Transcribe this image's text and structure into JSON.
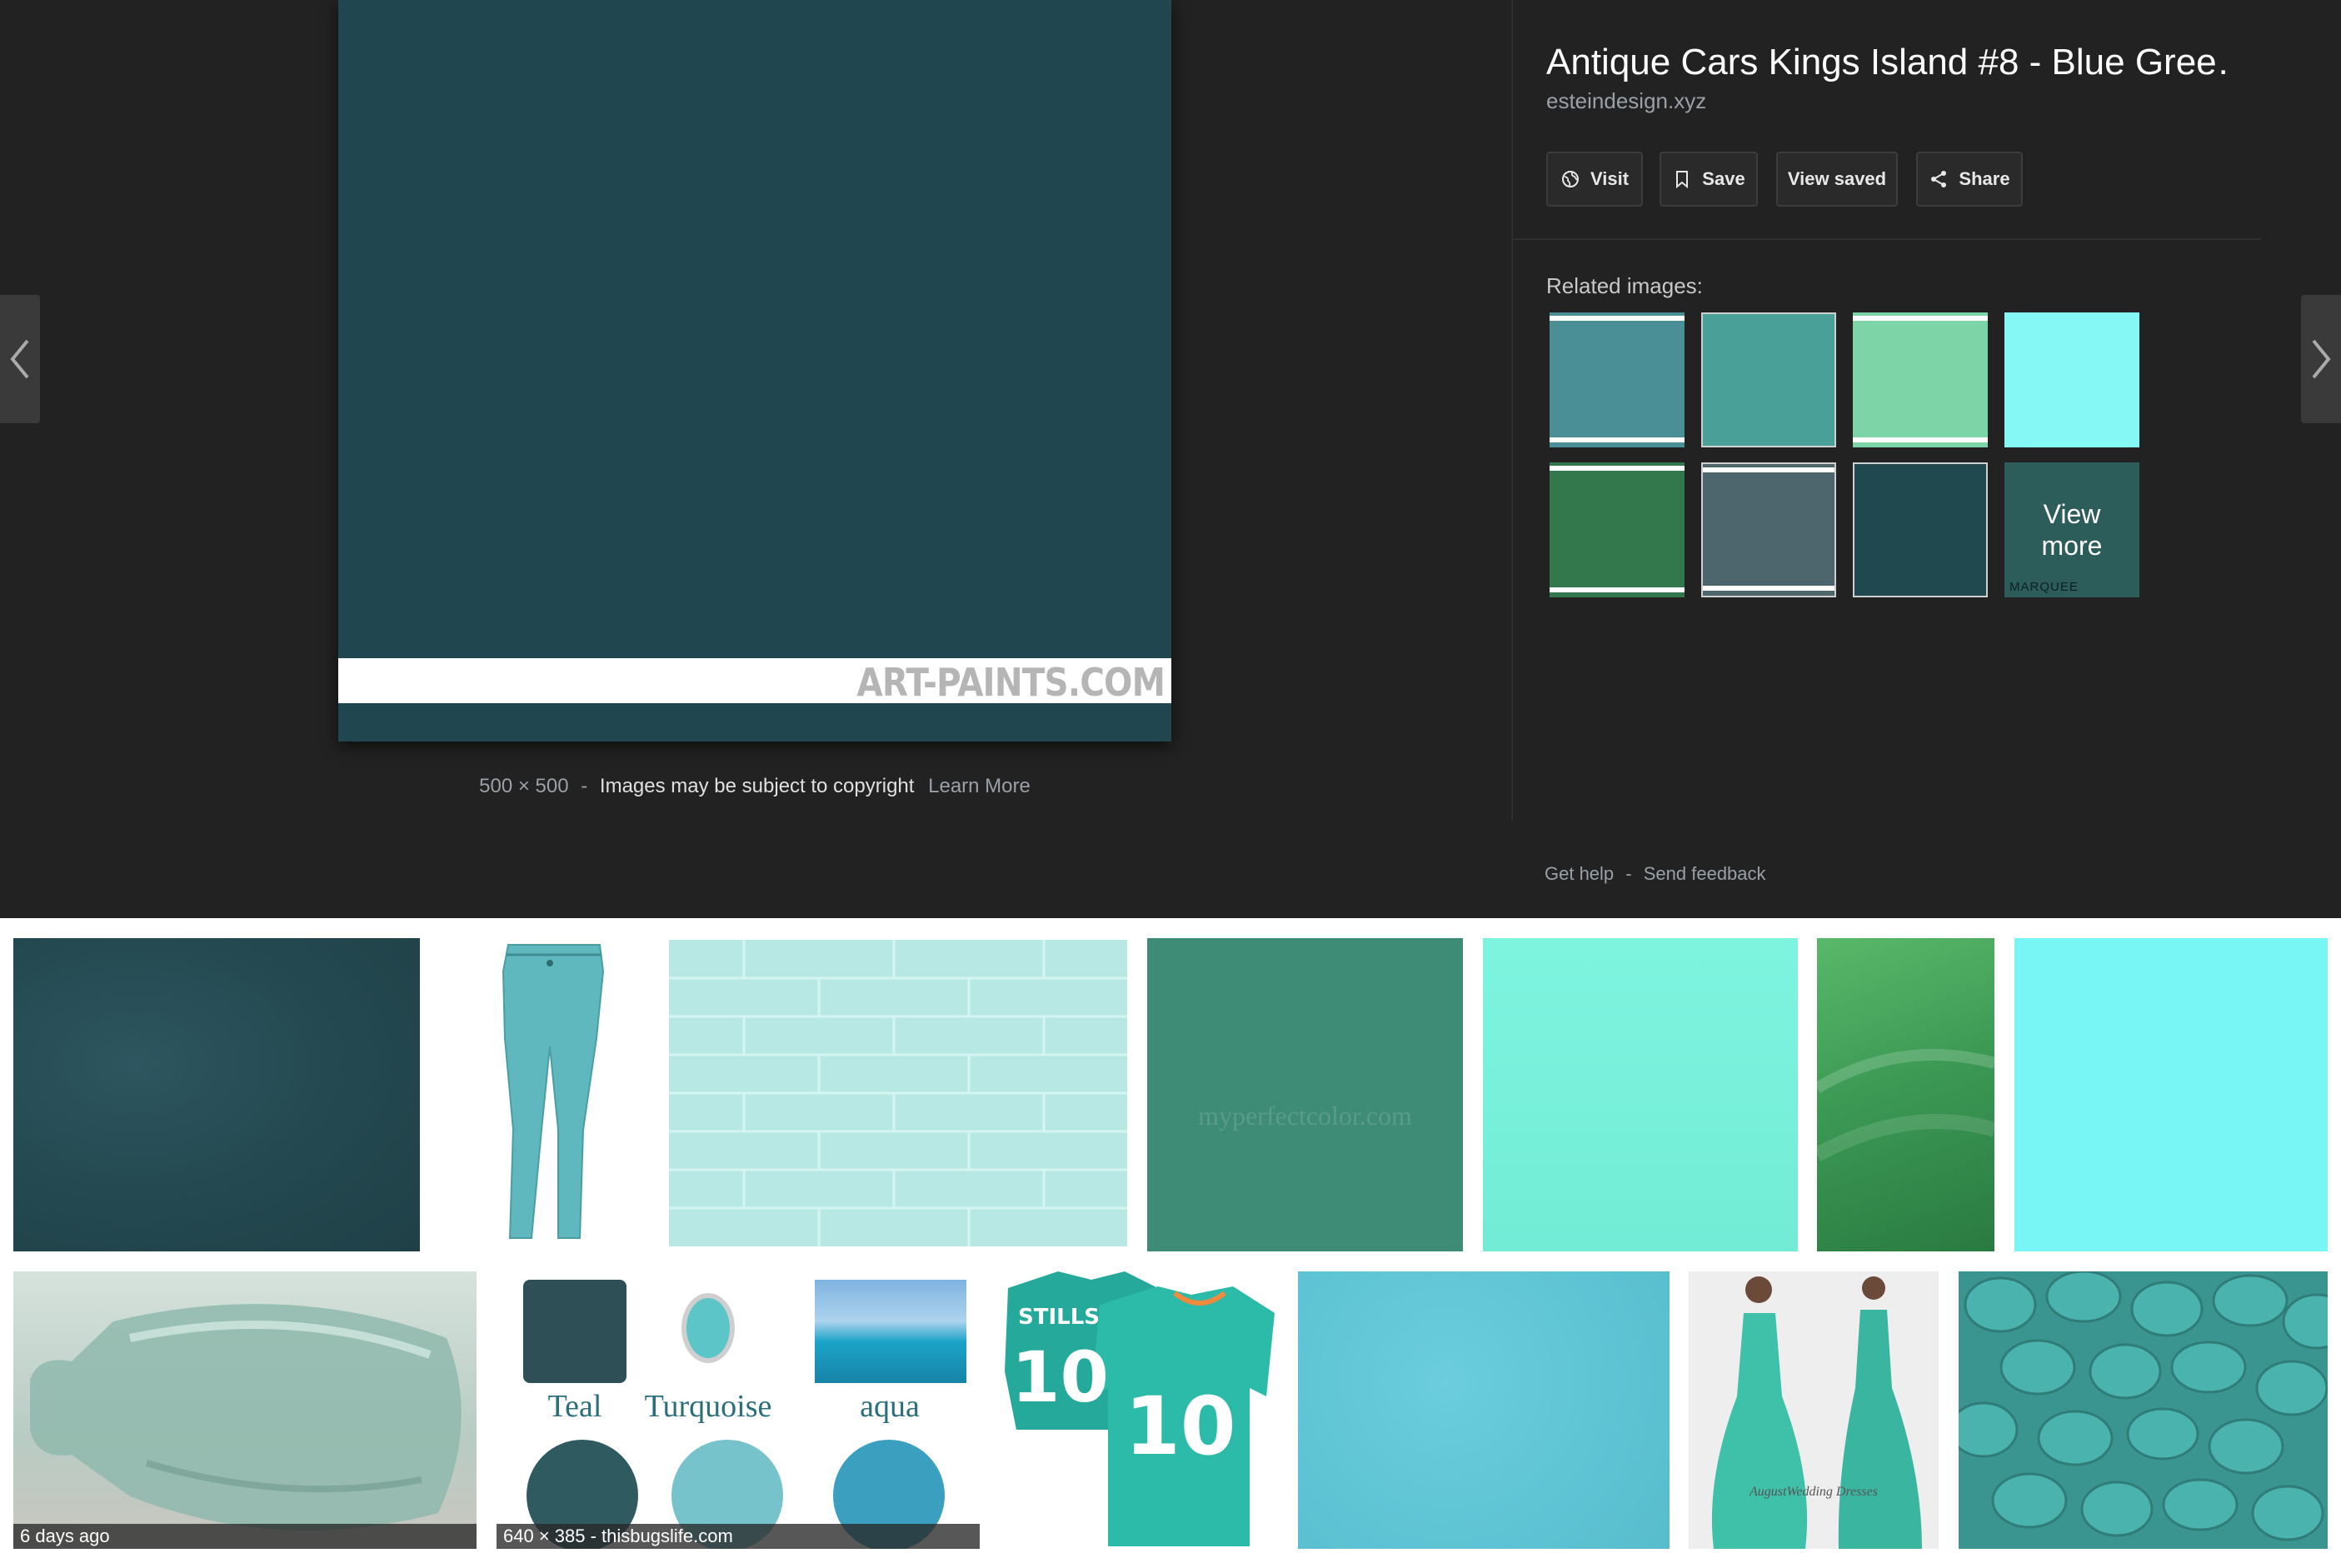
{
  "viewer": {
    "prev_label": "Previous image",
    "next_label": "Next image",
    "main_image": {
      "watermark": "ART-PAINTS.COM",
      "color": "#204650"
    },
    "meta": {
      "dimensions": "500 × 500",
      "separator": "-",
      "copyright": "Images may be subject to copyright",
      "learn_more": "Learn More"
    }
  },
  "info": {
    "title": "Antique Cars Kings Island #8 - Blue Gree…",
    "source": "esteindesign.xyz",
    "actions": {
      "visit": "Visit",
      "save": "Save",
      "view_saved": "View saved",
      "share": "Share"
    },
    "related_label": "Related images:",
    "related": [
      {
        "color": "#4a8f96",
        "bars": true
      },
      {
        "color": "#48a099",
        "bars": false,
        "bordered": true
      },
      {
        "color": "#7dd5a7",
        "bars": true
      },
      {
        "color": "#85f7f4",
        "bars": false
      },
      {
        "color": "#33774c",
        "bars": true
      },
      {
        "color": "#4d666d",
        "bars": true,
        "bordered": true
      },
      {
        "color": "#1f484f",
        "bars": false,
        "bordered": true
      },
      {
        "color": "#2c5d5a",
        "bars": false
      }
    ],
    "view_more": "View more",
    "view_more_brand": "MARQUEE",
    "footer": {
      "help": "Get help",
      "separator": "-",
      "feedback": "Send feedback"
    }
  },
  "grid": {
    "row1": [
      {
        "name": "dark-teal-fabric",
        "color": "#264a52"
      },
      {
        "name": "teal-jeans",
        "color": "#ffffff"
      },
      {
        "name": "mint-brick-wall",
        "color": "#b7e8e4"
      },
      {
        "name": "green-swatch",
        "color": "#3e8b76",
        "watermark": "myperfectcolor.com"
      },
      {
        "name": "aquamarine-swatch",
        "color": "#79f1dc"
      },
      {
        "name": "green-abstract",
        "color": "#3c9a55"
      },
      {
        "name": "light-cyan-swatch",
        "color": "#78f6f5"
      }
    ],
    "row2": [
      {
        "name": "glass-bottle",
        "color": "#a7c3bd",
        "caption": "6 days ago"
      },
      {
        "name": "teal-turquoise-aqua",
        "color": "#ffffff",
        "caption": "640 × 385 - thisbugslife.com",
        "labels": [
          "Teal",
          "Turquoise",
          "aqua"
        ]
      },
      {
        "name": "dolphins-jersey",
        "color": "#ffffff",
        "jersey_name": "STILLS",
        "jersey_number": "10"
      },
      {
        "name": "sky-blue-texture",
        "color": "#62c6d6"
      },
      {
        "name": "mermaid-dress",
        "color": "#eeeeee",
        "caption_text": "AugustWedding Dresses"
      },
      {
        "name": "teal-mms",
        "color": "#3f9c98"
      }
    ]
  }
}
